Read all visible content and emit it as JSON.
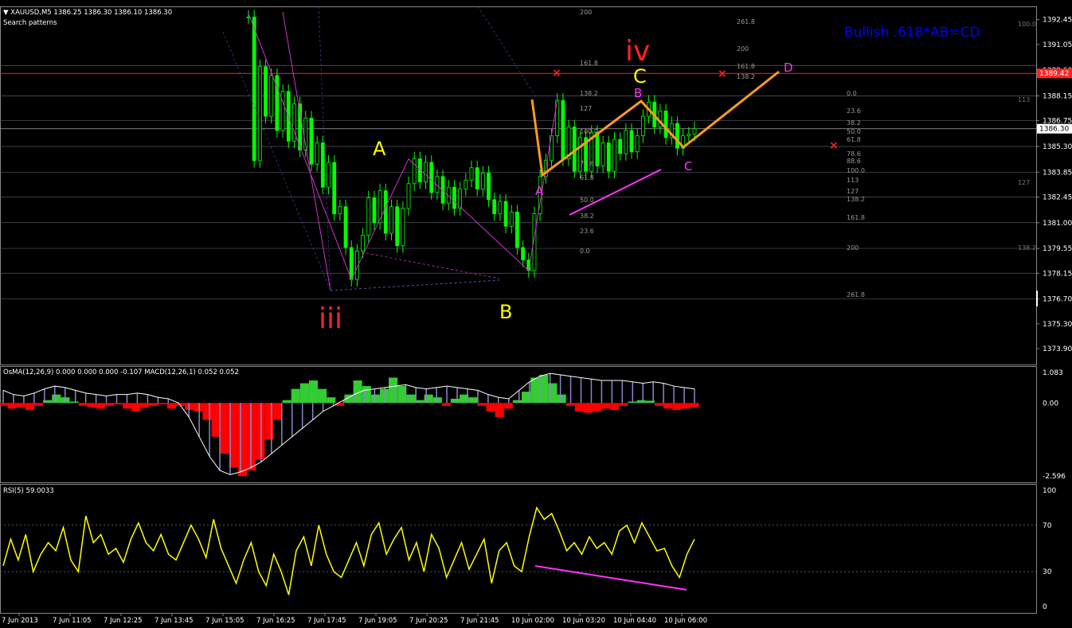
{
  "header": {
    "symbol_info": "XAUUSD,M5  1386.25 1386.30 1386.10 1386.30",
    "subtitle": "Search patterns",
    "osma_info": "OsMA(12,26,9) 0.000 0.000 0.000 -0.107  MACD(12,26,1) 0.052 0.052",
    "rsi_info": "RSI(5) 59.0033"
  },
  "pattern_title": "Bullish .618*AB=CD",
  "colors": {
    "background": "#000000",
    "candle": "#00ff00",
    "pattern_line": "#ff9922",
    "rsi": "#ffff00",
    "osma_pos": "#33cc33",
    "osma_neg": "#ff0000",
    "current_price_bg": "#ffffff",
    "marked_price_bg": "#ff2222",
    "title": "#0000ff"
  },
  "chart_data": [
    {
      "type": "candlestick",
      "symbol": "XAUUSD",
      "timeframe": "M5",
      "ylim": [
        1373.0,
        1393.2
      ],
      "y_ticks": [
        "1392.45",
        "1391.05",
        "1389.60",
        "1388.15",
        "1386.75",
        "1385.30",
        "1383.85",
        "1382.45",
        "1381.00",
        "1379.55",
        "1378.15",
        "1376.70",
        "1375.30",
        "1373.90"
      ],
      "current_price": "1386.30",
      "marked_price": "1389.42",
      "x_ticks": [
        "7 Jun 2013",
        "7 Jun 11:05",
        "7 Jun 12:25",
        "7 Jun 13:45",
        "7 Jun 15:05",
        "7 Jun 16:25",
        "7 Jun 17:45",
        "7 Jun 19:05",
        "7 Jun 20:25",
        "7 Jun 21:45",
        "10 Jun 02:00",
        "10 Jun 03:20",
        "10 Jun 04:40",
        "10 Jun 06:00"
      ],
      "closes": [
        1392.6,
        1384.5,
        1389.8,
        1387.0,
        1389.3,
        1386.2,
        1388.4,
        1385.6,
        1387.7,
        1385.1,
        1386.9,
        1384.3,
        1385.5,
        1383.0,
        1384.4,
        1381.5,
        1381.9,
        1379.6,
        1377.8,
        1379.4,
        1380.3,
        1382.4,
        1381.0,
        1382.8,
        1380.4,
        1381.9,
        1379.7,
        1381.8,
        1383.2,
        1384.6,
        1383.3,
        1384.4,
        1382.7,
        1383.6,
        1382.1,
        1383.0,
        1381.8,
        1382.9,
        1383.4,
        1384.1,
        1382.9,
        1383.8,
        1382.3,
        1381.5,
        1382.2,
        1380.8,
        1381.6,
        1379.6,
        1378.9,
        1378.3,
        1381.5,
        1383.6,
        1384.5,
        1385.9,
        1387.9,
        1384.6,
        1386.4,
        1383.9,
        1385.8,
        1383.9,
        1386.1,
        1384.2,
        1385.5,
        1383.9,
        1385.7,
        1384.9,
        1386.2,
        1385.0,
        1385.9,
        1387.0,
        1387.8,
        1386.4,
        1387.3,
        1385.8,
        1386.6,
        1385.2,
        1385.9,
        1386.0,
        1386.3
      ]
    },
    {
      "type": "histogram",
      "name": "OsMA(12,26,9)",
      "ylim": [
        -2.596,
        1.083
      ],
      "y_ticks": [
        "1.083",
        "0.00",
        "-2.596"
      ],
      "values": [
        -0.1,
        -0.2,
        -0.15,
        -0.25,
        -0.1,
        0.1,
        0.3,
        0.2,
        0.05,
        -0.1,
        -0.15,
        -0.2,
        -0.1,
        -0.05,
        -0.2,
        -0.3,
        -0.15,
        -0.1,
        -0.05,
        -0.2,
        -0.1,
        -0.25,
        -0.3,
        -0.6,
        -1.2,
        -1.8,
        -2.3,
        -2.6,
        -2.4,
        -2.0,
        -1.3,
        -0.6,
        0.1,
        0.5,
        0.7,
        0.8,
        0.5,
        0.2,
        -0.1,
        0.3,
        0.8,
        0.6,
        0.3,
        0.5,
        0.9,
        0.6,
        0.3,
        0.1,
        0.3,
        0.2,
        -0.1,
        0.15,
        0.3,
        0.2,
        -0.1,
        -0.3,
        -0.5,
        -0.2,
        0.1,
        0.4,
        0.9,
        1.0,
        0.7,
        0.3,
        -0.1,
        -0.3,
        -0.35,
        -0.3,
        -0.2,
        -0.25,
        -0.1,
        0.05,
        0.1,
        0.08,
        -0.1,
        -0.2,
        -0.25,
        -0.2,
        -0.15
      ],
      "line": [
        0.45,
        0.3,
        0.25,
        0.35,
        0.5,
        0.6,
        0.55,
        0.45,
        0.35,
        0.3,
        0.25,
        0.3,
        0.3,
        0.35,
        0.3,
        0.2,
        0.15,
        0.0,
        -0.5,
        -1.2,
        -1.9,
        -2.4,
        -2.55,
        -2.45,
        -2.3,
        -2.1,
        -1.8,
        -1.5,
        -1.2,
        -0.9,
        -0.6,
        -0.3,
        -0.1,
        0.1,
        0.3,
        0.45,
        0.5,
        0.55,
        0.6,
        0.65,
        0.55,
        0.5,
        0.55,
        0.6,
        0.55,
        0.5,
        0.45,
        0.3,
        0.2,
        0.15,
        0.45,
        0.75,
        0.95,
        1.05,
        1.0,
        0.95,
        0.9,
        0.85,
        0.8,
        0.8,
        0.8,
        0.75,
        0.7,
        0.75,
        0.7,
        0.6,
        0.55,
        0.5
      ]
    },
    {
      "type": "line",
      "name": "RSI(5)",
      "ylim": [
        0,
        100
      ],
      "y_ticks": [
        "100",
        "70",
        "30",
        "0"
      ],
      "levels": [
        70,
        30
      ],
      "values": [
        35,
        58,
        40,
        62,
        30,
        45,
        55,
        48,
        68,
        40,
        30,
        78,
        55,
        62,
        45,
        50,
        38,
        58,
        72,
        55,
        48,
        62,
        45,
        40,
        55,
        70,
        58,
        42,
        75,
        50,
        35,
        20,
        40,
        55,
        30,
        18,
        45,
        30,
        10,
        48,
        60,
        35,
        70,
        45,
        30,
        25,
        40,
        55,
        35,
        62,
        72,
        45,
        58,
        68,
        40,
        55,
        30,
        62,
        50,
        25,
        40,
        55,
        32,
        45,
        58,
        20,
        48,
        55,
        35,
        30,
        60,
        85,
        75,
        80,
        65,
        48,
        55,
        45,
        60,
        50,
        55,
        45,
        65,
        70,
        55,
        72,
        60,
        48,
        50,
        35,
        25,
        45,
        58
      ]
    }
  ],
  "annotations": {
    "wave_iii": "iii",
    "wave_iv": "iv",
    "left_a": "A",
    "left_b": "B",
    "left_c": "C",
    "abcd_a": "A",
    "abcd_b": "B",
    "abcd_c": "C",
    "abcd_d": "D",
    "fib_left": [
      "200",
      "161.8",
      "138.2",
      "127",
      "100.0",
      "78.6",
      "61.8",
      "50.0",
      "38.2",
      "23.6",
      "0.0"
    ],
    "fib_right_top": [
      "261.8",
      "200",
      "161.8",
      "138.2",
      "0.0",
      "23.6",
      "38.2",
      "50.0",
      "61.8",
      "78.6",
      "88.6",
      "100.0",
      "113",
      "127",
      "138.2",
      "161.8",
      "200",
      "261.8"
    ],
    "fib_far_right": [
      "100.0",
      "113",
      "127",
      "138.2"
    ]
  }
}
